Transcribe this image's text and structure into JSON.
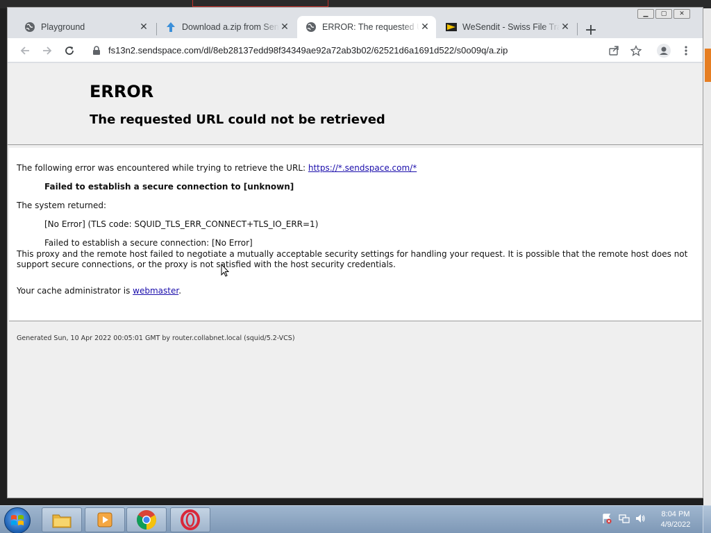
{
  "browser": {
    "tabs": [
      {
        "title": "Playground",
        "icon": "globe-icon",
        "active": false
      },
      {
        "title": "Download a.zip from Sendspace",
        "icon": "upload-arrow-icon",
        "active": false
      },
      {
        "title": "ERROR: The requested URL could not be retrieved",
        "icon": "globe-icon",
        "active": true
      },
      {
        "title": "WeSendit - Swiss File Transfer",
        "icon": "wesendit-icon",
        "active": false
      }
    ],
    "address": "fs13n2.sendspace.com/dl/8eb28137edd98f34349ae92a72ab3b02/62521d6a1691d522/s0o09q/a.zip"
  },
  "page": {
    "heading": "ERROR",
    "subheading": "The requested URL could not be retrieved",
    "intro_text": "The following error was encountered while trying to retrieve the URL: ",
    "url_link": "https://*.sendspace.com/*",
    "failure": "Failed to establish a secure connection to [unknown]",
    "system_returned": "The system returned:",
    "error_code": "[No Error] (TLS code: SQUID_TLS_ERR_CONNECT+TLS_IO_ERR=1)",
    "error_detail": "Failed to establish a secure connection: [No Error]",
    "explanation": "This proxy and the remote host failed to negotiate a mutually acceptable security settings for handling your request. It is possible that the remote host does not support secure connections, or the proxy is not satisfied with the host security credentials.",
    "admin_prefix": "Your cache administrator is ",
    "admin_link": "webmaster",
    "admin_suffix": ".",
    "footer": "Generated Sun, 10 Apr 2022 00:05:01 GMT by router.collabnet.local (squid/5.2-VCS)"
  },
  "taskbar": {
    "time": "8:04 PM",
    "date": "4/9/2022"
  },
  "colors": {
    "link": "#1a0dab",
    "tab_strip": "#dee1e6",
    "taskbar": "#8fa7c3"
  }
}
